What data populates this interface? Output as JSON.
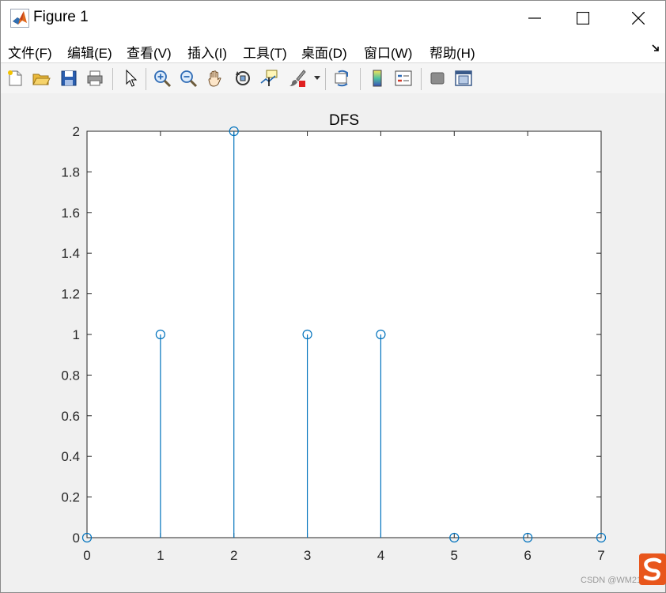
{
  "window": {
    "title": "Figure 1"
  },
  "menu": {
    "items": [
      {
        "label": "文件(F)"
      },
      {
        "label": "编辑(E)"
      },
      {
        "label": "查看(V)"
      },
      {
        "label": "插入(I)"
      },
      {
        "label": "工具(T)"
      },
      {
        "label": "桌面(D)"
      },
      {
        "label": "窗口(W)"
      },
      {
        "label": "帮助(H)"
      }
    ]
  },
  "toolbar": {
    "icons": [
      "new-figure-icon",
      "open-file-icon",
      "save-icon",
      "print-icon",
      "pointer-icon",
      "zoom-in-icon",
      "zoom-out-icon",
      "pan-hand-icon",
      "rotate-3d-icon",
      "data-cursor-icon",
      "brush-icon",
      "link-plot-icon",
      "colorbar-icon",
      "legend-icon",
      "hide-plot-tools-icon",
      "show-plot-tools-icon"
    ]
  },
  "chart_data": {
    "type": "stem",
    "title": "DFS",
    "xlabel": "",
    "ylabel": "",
    "x": [
      0,
      1,
      2,
      3,
      4,
      5,
      6,
      7
    ],
    "y": [
      0,
      1,
      2,
      1,
      1,
      0,
      0,
      0
    ],
    "xlim": [
      0,
      7
    ],
    "ylim": [
      0,
      2
    ],
    "xticks": [
      "0",
      "1",
      "2",
      "3",
      "4",
      "5",
      "6",
      "7"
    ],
    "yticks": [
      "0",
      "0.2",
      "0.4",
      "0.6",
      "0.8",
      "1",
      "1.2",
      "1.4",
      "1.6",
      "1.8",
      "2"
    ],
    "color": "#0072bd",
    "marker": "circle-open",
    "grid": false
  },
  "watermark": "CSDN @WM2101"
}
